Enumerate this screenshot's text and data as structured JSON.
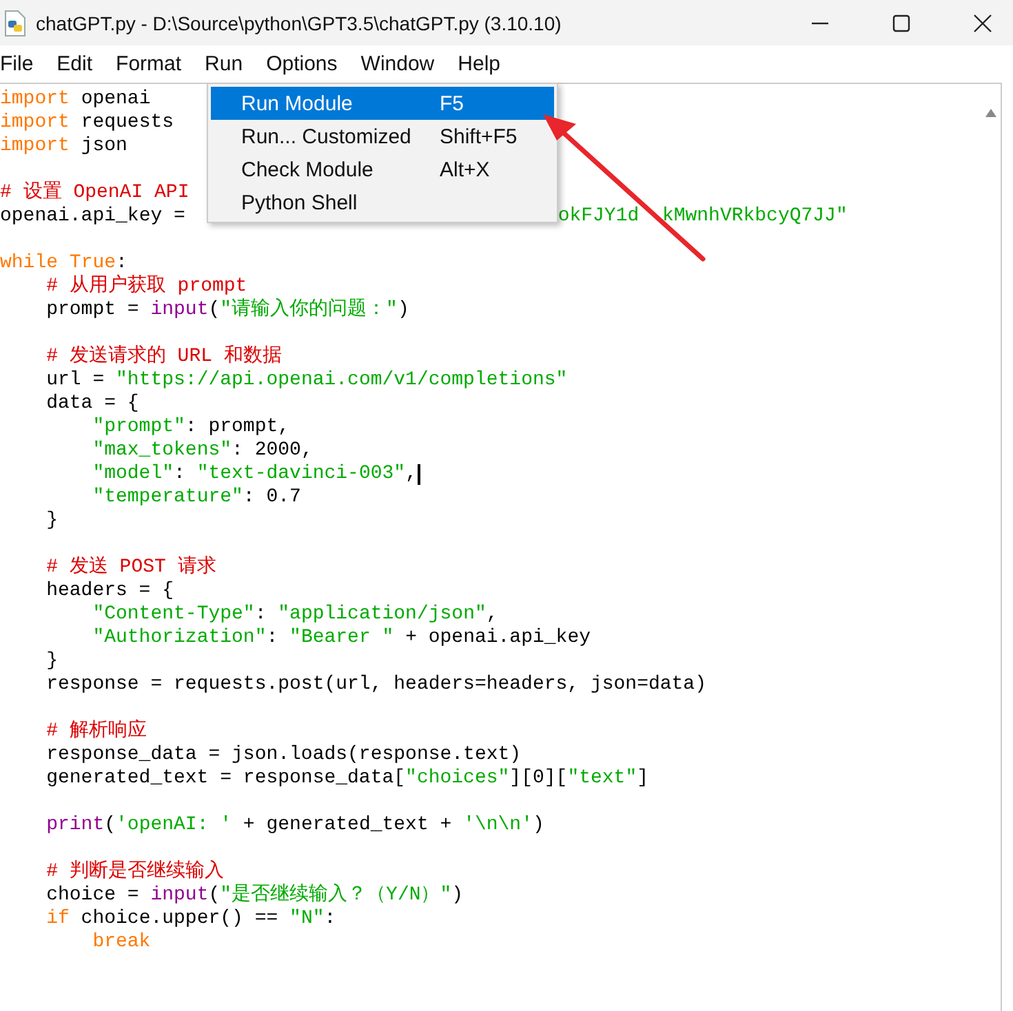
{
  "window": {
    "title": "chatGPT.py - D:\\Source\\python\\GPT3.5\\chatGPT.py (3.10.10)"
  },
  "menu_bar": [
    {
      "label": "File"
    },
    {
      "label": "Edit"
    },
    {
      "label": "Format"
    },
    {
      "label": "Run"
    },
    {
      "label": "Options"
    },
    {
      "label": "Window"
    },
    {
      "label": "Help"
    }
  ],
  "dropdown": [
    {
      "label": "Run Module",
      "shortcut": "F5",
      "selected": true
    },
    {
      "label": "Run... Customized",
      "shortcut": "Shift+F5",
      "selected": false
    },
    {
      "label": "Check Module",
      "shortcut": "Alt+X",
      "selected": false
    },
    {
      "label": "Python Shell",
      "selected": false
    }
  ],
  "editor": {
    "lines": [
      {
        "kind": "code",
        "tokens": [
          {
            "kind": "kw",
            "text": "import"
          },
          {
            "kind": "plain",
            "text": " openai"
          }
        ]
      },
      {
        "kind": "code",
        "tokens": [
          {
            "kind": "kw",
            "text": "import"
          },
          {
            "kind": "plain",
            "text": " requests"
          }
        ]
      },
      {
        "kind": "code",
        "tokens": [
          {
            "kind": "kw",
            "text": "import"
          },
          {
            "kind": "plain",
            "text": " json"
          }
        ]
      },
      {
        "kind": "blank"
      },
      {
        "kind": "code",
        "tokens": [
          {
            "kind": "cmt",
            "text": "# 设置 OpenAI API"
          }
        ]
      },
      {
        "kind": "code",
        "tokens": [
          {
            "kind": "plain",
            "text": "openai.api_key = "
          },
          {
            "kind": "str",
            "text": "okFJY1d",
            "obscured": true
          },
          {
            "kind": "str",
            "text": "kMwnhVRkbcyQ7JJ\"",
            "crossed": true
          }
        ]
      },
      {
        "kind": "blank"
      },
      {
        "kind": "code",
        "tokens": [
          {
            "kind": "kw",
            "text": "while"
          },
          {
            "kind": "kw",
            "text": " True"
          },
          {
            "kind": "plain",
            "text": ":"
          }
        ],
        "children": [
          {
            "kind": "code",
            "tokens": [
              {
                "kind": "cmt",
                "text": "# 从用户获取 prompt"
              }
            ]
          },
          {
            "kind": "code",
            "tokens": [
              {
                "kind": "plain",
                "text": "prompt = "
              },
              {
                "kind": "builtin",
                "text": "input"
              },
              {
                "kind": "plain",
                "text": "("
              },
              {
                "kind": "str",
                "text": "\"请输入你的问题：\""
              },
              {
                "kind": "plain",
                "text": ")"
              }
            ]
          },
          {
            "kind": "blank"
          },
          {
            "kind": "code",
            "tokens": [
              {
                "kind": "cmt",
                "text": "# 发送请求的 URL 和数据"
              }
            ]
          },
          {
            "kind": "code",
            "tokens": [
              {
                "kind": "plain",
                "text": "url = "
              },
              {
                "kind": "str",
                "text": "\"https://api.openai.com/v1/completions\""
              }
            ]
          },
          {
            "kind": "code",
            "tokens": [
              {
                "kind": "plain",
                "text": "data = {"
              }
            ],
            "children": [
              {
                "kind": "code",
                "tokens": [
                  {
                    "kind": "str",
                    "text": "\"prompt\""
                  },
                  {
                    "kind": "plain",
                    "text": ": prompt,"
                  }
                ]
              },
              {
                "kind": "code",
                "tokens": [
                  {
                    "kind": "str",
                    "text": "\"max_tokens\""
                  },
                  {
                    "kind": "plain",
                    "text": ": 2000,"
                  }
                ]
              },
              {
                "kind": "code",
                "cursor": true,
                "tokens": [
                  {
                    "kind": "str",
                    "text": "\"model\""
                  },
                  {
                    "kind": "plain",
                    "text": ": "
                  },
                  {
                    "kind": "str",
                    "text": "\"text-davinci-003\""
                  },
                  {
                    "kind": "plain",
                    "text": ","
                  }
                ]
              },
              {
                "kind": "code",
                "tokens": [
                  {
                    "kind": "str",
                    "text": "\"temperature\""
                  },
                  {
                    "kind": "plain",
                    "text": ": 0.7"
                  }
                ]
              }
            ]
          },
          {
            "kind": "code",
            "tokens": [
              {
                "kind": "plain",
                "text": "}"
              }
            ]
          },
          {
            "kind": "blank"
          },
          {
            "kind": "code",
            "tokens": [
              {
                "kind": "cmt",
                "text": "# 发送 POST 请求"
              }
            ]
          },
          {
            "kind": "code",
            "tokens": [
              {
                "kind": "plain",
                "text": "headers = {"
              }
            ],
            "children": [
              {
                "kind": "code",
                "tokens": [
                  {
                    "kind": "str",
                    "text": "\"Content-Type\""
                  },
                  {
                    "kind": "plain",
                    "text": ": "
                  },
                  {
                    "kind": "str",
                    "text": "\"application/json\""
                  },
                  {
                    "kind": "plain",
                    "text": ","
                  }
                ]
              },
              {
                "kind": "code",
                "tokens": [
                  {
                    "kind": "str",
                    "text": "\"Authorization\""
                  },
                  {
                    "kind": "plain",
                    "text": ": "
                  },
                  {
                    "kind": "str",
                    "text": "\"Bearer \""
                  },
                  {
                    "kind": "plain",
                    "text": " + openai.api_key"
                  }
                ]
              }
            ]
          },
          {
            "kind": "code",
            "tokens": [
              {
                "kind": "plain",
                "text": "}"
              }
            ]
          },
          {
            "kind": "code",
            "tokens": [
              {
                "kind": "plain",
                "text": "response = requests.post(url, headers=headers, json=data)"
              }
            ]
          },
          {
            "kind": "blank"
          },
          {
            "kind": "code",
            "tokens": [
              {
                "kind": "cmt",
                "text": "# 解析响应"
              }
            ]
          },
          {
            "kind": "code",
            "tokens": [
              {
                "kind": "plain",
                "text": "response_data = json.loads(response.text)"
              }
            ]
          },
          {
            "kind": "code",
            "tokens": [
              {
                "kind": "plain",
                "text": "generated_text = response_data["
              },
              {
                "kind": "str",
                "text": "\"choices\""
              },
              {
                "kind": "plain",
                "text": "][0]["
              },
              {
                "kind": "str",
                "text": "\"text\""
              },
              {
                "kind": "plain",
                "text": "]"
              }
            ]
          },
          {
            "kind": "blank"
          },
          {
            "kind": "code",
            "tokens": [
              {
                "kind": "builtin",
                "text": "print"
              },
              {
                "kind": "plain",
                "text": "("
              },
              {
                "kind": "str",
                "text": "'openAI: '"
              },
              {
                "kind": "plain",
                "text": " + generated_text + "
              },
              {
                "kind": "str",
                "text": "'\\n\\n'"
              },
              {
                "kind": "plain",
                "text": ")"
              }
            ]
          },
          {
            "kind": "blank"
          },
          {
            "kind": "code",
            "tokens": [
              {
                "kind": "cmt",
                "text": "# 判断是否继续输入"
              }
            ]
          },
          {
            "kind": "code",
            "tokens": [
              {
                "kind": "plain",
                "text": "choice = "
              },
              {
                "kind": "builtin",
                "text": "input"
              },
              {
                "kind": "plain",
                "text": "("
              },
              {
                "kind": "str",
                "text": "\"是否继续输入？（Y/N）\""
              },
              {
                "kind": "plain",
                "text": ")"
              }
            ]
          },
          {
            "kind": "code",
            "tokens": [
              {
                "kind": "kw",
                "text": "if"
              },
              {
                "kind": "plain",
                "text": " choice.upper() == "
              },
              {
                "kind": "str",
                "text": "\"N\""
              },
              {
                "kind": "plain",
                "text": ":"
              }
            ],
            "children": [
              {
                "kind": "code",
                "tokens": [
                  {
                    "kind": "kw",
                    "text": "break"
                  }
                ]
              }
            ]
          }
        ]
      }
    ]
  }
}
